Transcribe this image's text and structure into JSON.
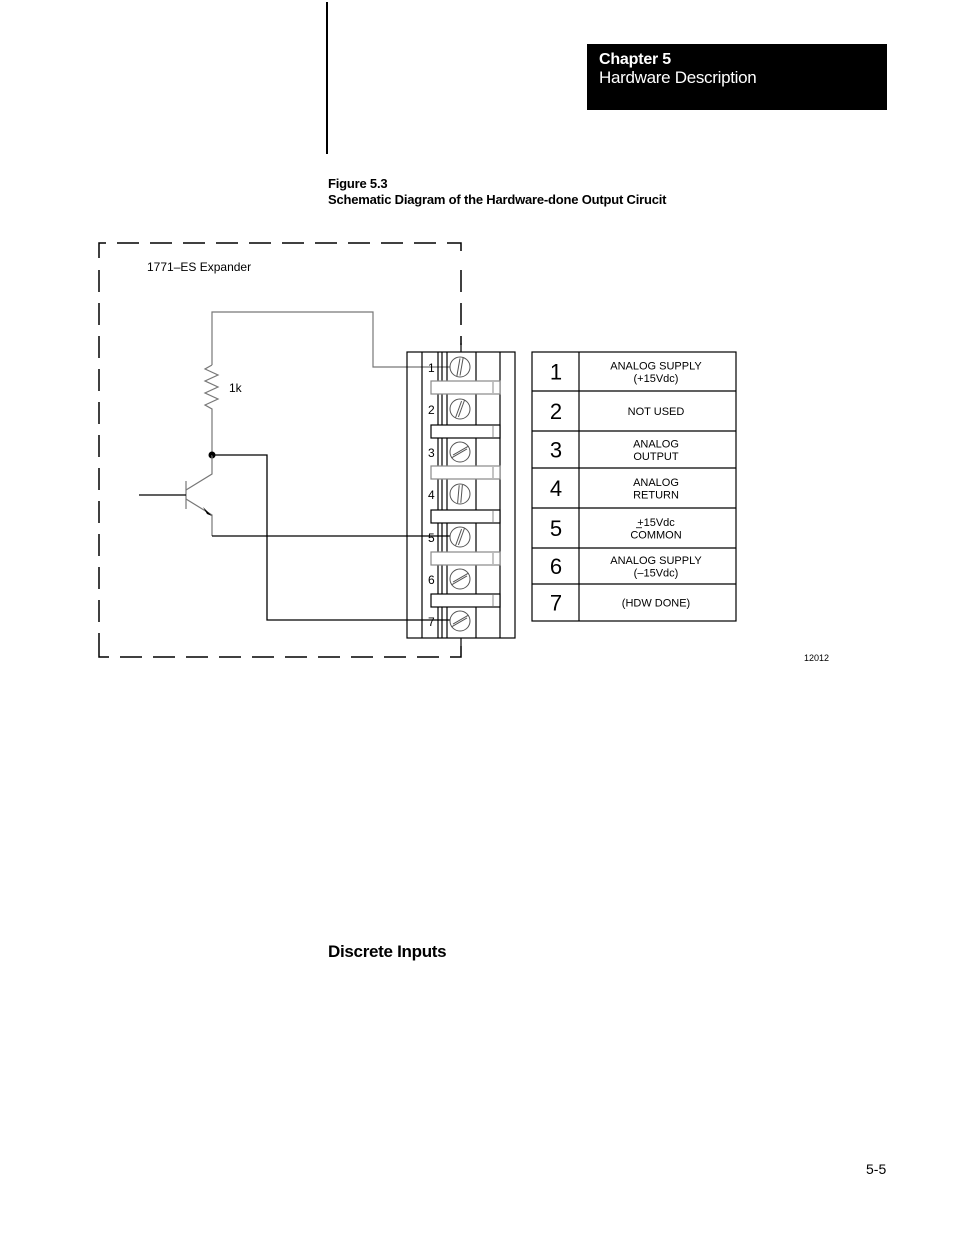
{
  "header": {
    "chapter_label": "Chapter 5",
    "chapter_title": "Hardware Description"
  },
  "figure": {
    "number": "Figure 5.3",
    "title": "Schematic Diagram of the Hardware-done Output Cirucit",
    "module_label": "1771–ES  Expander",
    "resistor_label": "1k",
    "figure_id": "12012",
    "terminal_numbers": [
      "1",
      "2",
      "3",
      "4",
      "5",
      "6",
      "7"
    ],
    "terminal_table": [
      {
        "num": "1",
        "lines": [
          "ANALOG SUPPLY",
          "(+15Vdc)"
        ]
      },
      {
        "num": "2",
        "lines": [
          "NOT USED"
        ]
      },
      {
        "num": "3",
        "lines": [
          "ANALOG",
          "OUTPUT"
        ]
      },
      {
        "num": "4",
        "lines": [
          "ANALOG",
          "RETURN"
        ]
      },
      {
        "num": "5",
        "lines": [
          "+15Vdc",
          "COMMON"
        ]
      },
      {
        "num": "6",
        "lines": [
          "ANALOG SUPPLY",
          "(–15Vdc)"
        ]
      },
      {
        "num": "7",
        "lines": [
          "(HDW DONE)"
        ]
      }
    ]
  },
  "section": {
    "heading": "Discrete Inputs"
  },
  "footer": {
    "page_number": "5-5"
  }
}
